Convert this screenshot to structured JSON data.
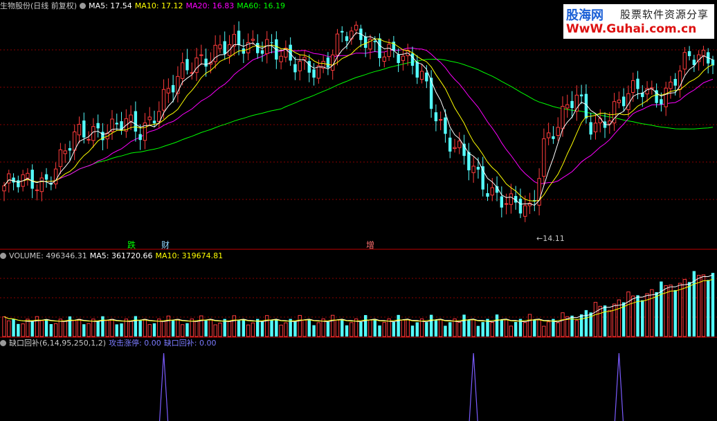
{
  "colors": {
    "up": "#ff3c3c",
    "down": "#54ffff",
    "ma5": "#ffffff",
    "ma10": "#ffff00",
    "ma20": "#ff00ff",
    "ma60": "#00ff00",
    "grid": "#8b0000",
    "divider": "#c00000",
    "spike": "#7b5cff",
    "text_dim": "#c8c8c8"
  },
  "header_main": {
    "title": "生物股份(日线 前复权)",
    "ma5": "MA5: 17.54",
    "ma10": "MA10: 17.12",
    "ma20": "MA20: 16.83",
    "ma60": "MA60: 16.19"
  },
  "header_volume": {
    "title": "VOLUME: 496346.31",
    "ma5": "MA5: 361720.66",
    "ma10": "MA10: 319674.81"
  },
  "header_indicator": {
    "title": "缺口回补(6,14,95,250,1,2)",
    "attack": "攻击涨停: 0.00",
    "gap": "缺口回补: 0.00"
  },
  "watermark": {
    "site_cn": "股海网",
    "slogan": "股票软件资源分享",
    "url": "WwW.Guhai.com.cn"
  },
  "annotations": {
    "tag_die": "跌",
    "tag_cai": "财",
    "tag_zeng": "增",
    "low_label": "←14.11"
  },
  "chart_data": [
    {
      "type": "candlestick",
      "panel": "price",
      "low_marker": 14.11,
      "ylim": [
        13.6,
        22.4
      ],
      "indicators": [
        "MA5",
        "MA10",
        "MA20",
        "MA60"
      ],
      "legend_placement": "top-left"
    },
    {
      "type": "bar",
      "panel": "volume",
      "latest": 496346.31,
      "ma5": 361720.66,
      "ma10": 319674.81
    },
    {
      "type": "line",
      "panel": "indicator",
      "series": [
        {
          "name": "攻击涨停",
          "latest": 0.0
        },
        {
          "name": "缺口回补",
          "latest": 0.0
        }
      ],
      "spikes_at_bar_index": [
        34,
        100,
        131
      ]
    }
  ]
}
